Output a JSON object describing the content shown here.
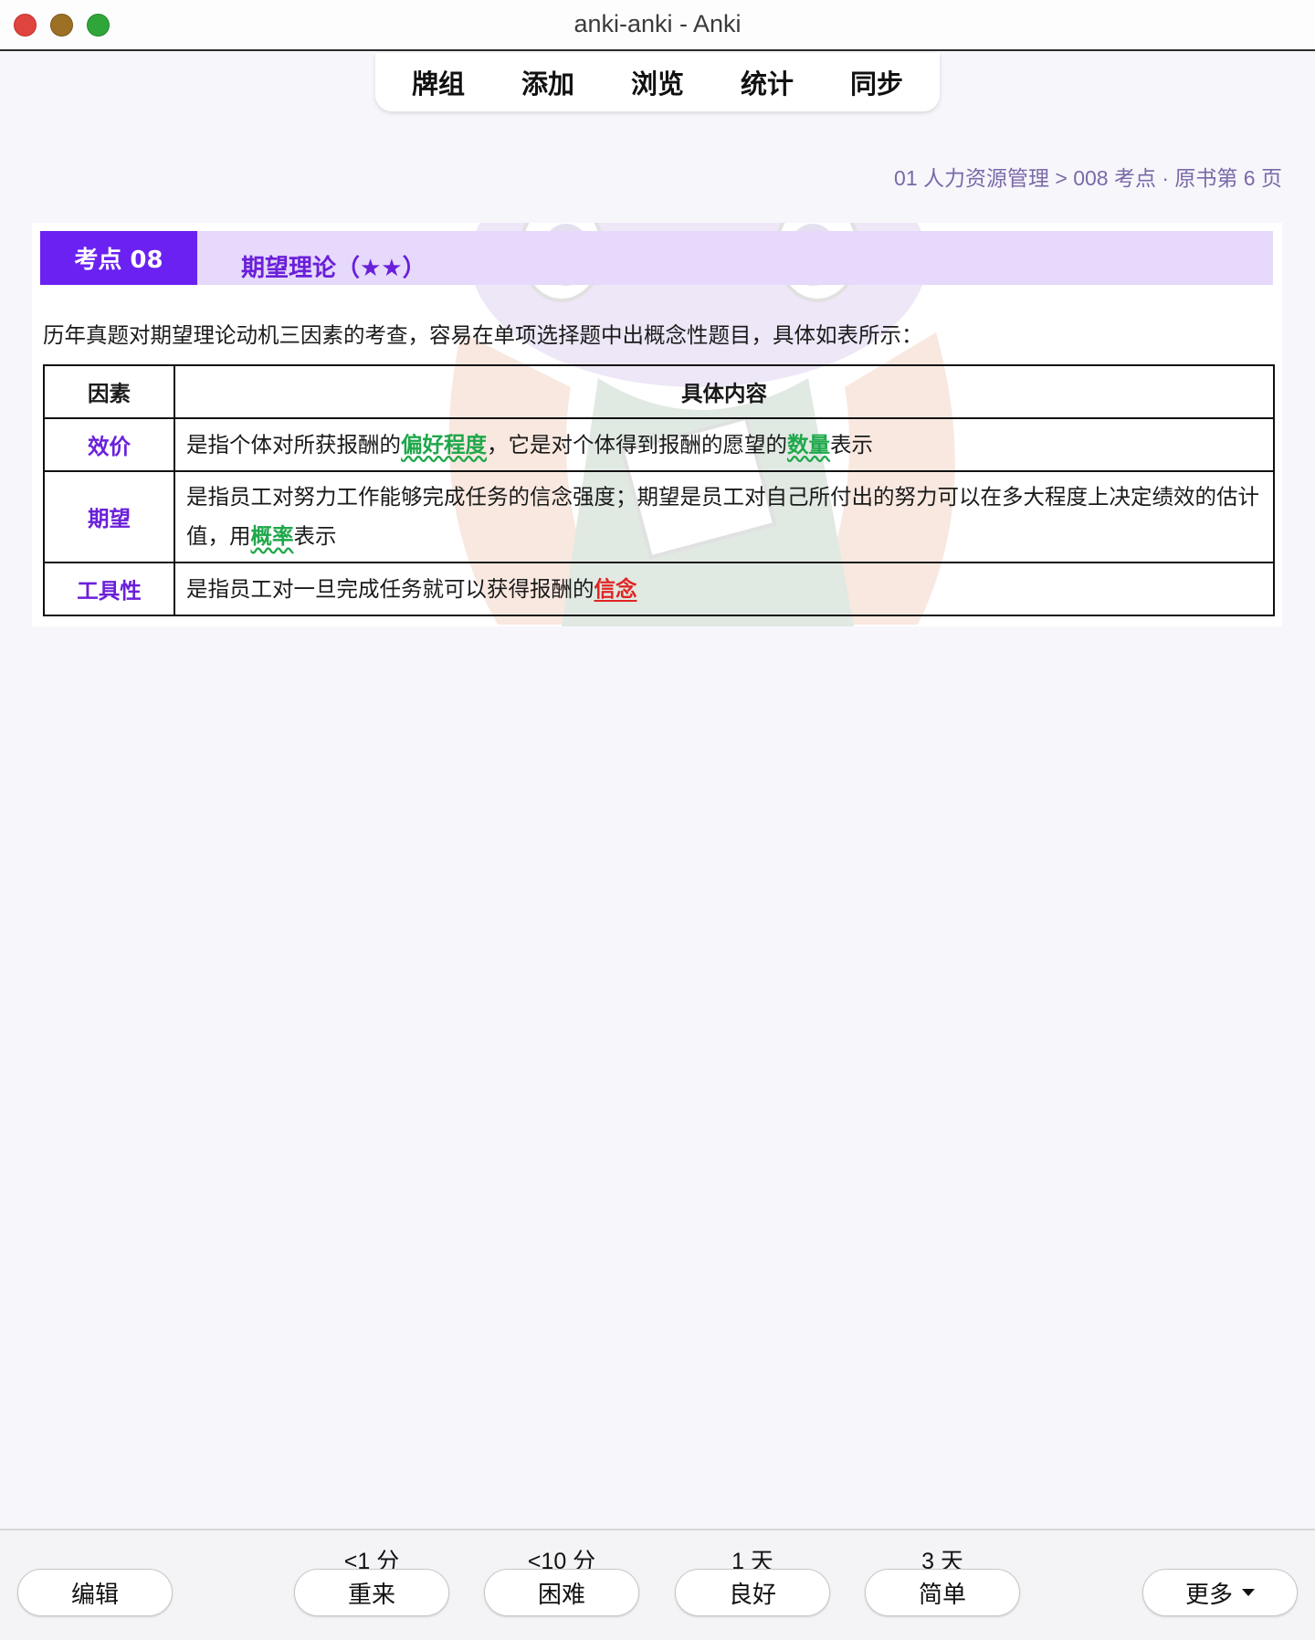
{
  "window": {
    "title": "anki-anki - Anki"
  },
  "topnav": {
    "items": [
      "牌组",
      "添加",
      "浏览",
      "统计",
      "同步"
    ]
  },
  "breadcrumb": "01 人力资源管理 > 008 考点 · 原书第 6 页",
  "card": {
    "badge": "考点  08",
    "title": "期望理论（★★）",
    "intro": "历年真题对期望理论动机三因素的考查，容易在单项选择题中出概念性题目，具体如表所示：",
    "table": {
      "headers": [
        "因素",
        "具体内容"
      ],
      "rows": [
        {
          "factor": "效价",
          "parts": [
            "是指个体对所获报酬的",
            "偏好程度",
            "，它是对个体得到报酬的愿望的",
            "数量",
            "表示"
          ]
        },
        {
          "factor": "期望",
          "parts": [
            "是指员工对努力工作能够完成任务的信念强度；期望是员工对自己所付出的努力可以在多大程度上决定绩效的估计值，用",
            "概率",
            "表示"
          ]
        },
        {
          "factor": "工具性",
          "parts": [
            "是指员工对一旦完成任务就可以获得报酬的",
            "信念"
          ]
        }
      ]
    }
  },
  "bottom": {
    "edit_label": "编辑",
    "more_label": "更多",
    "answers": [
      {
        "interval": "<1 分",
        "label": "重来"
      },
      {
        "interval": "<10 分",
        "label": "困难"
      },
      {
        "interval": "1 天",
        "label": "良好"
      },
      {
        "interval": "3 天",
        "label": "简单"
      }
    ]
  },
  "colors": {
    "accent_purple": "#6b21f2",
    "heading_bg": "#e6d9fb",
    "highlight_green": "#1fa84a",
    "highlight_red": "#e02424"
  }
}
